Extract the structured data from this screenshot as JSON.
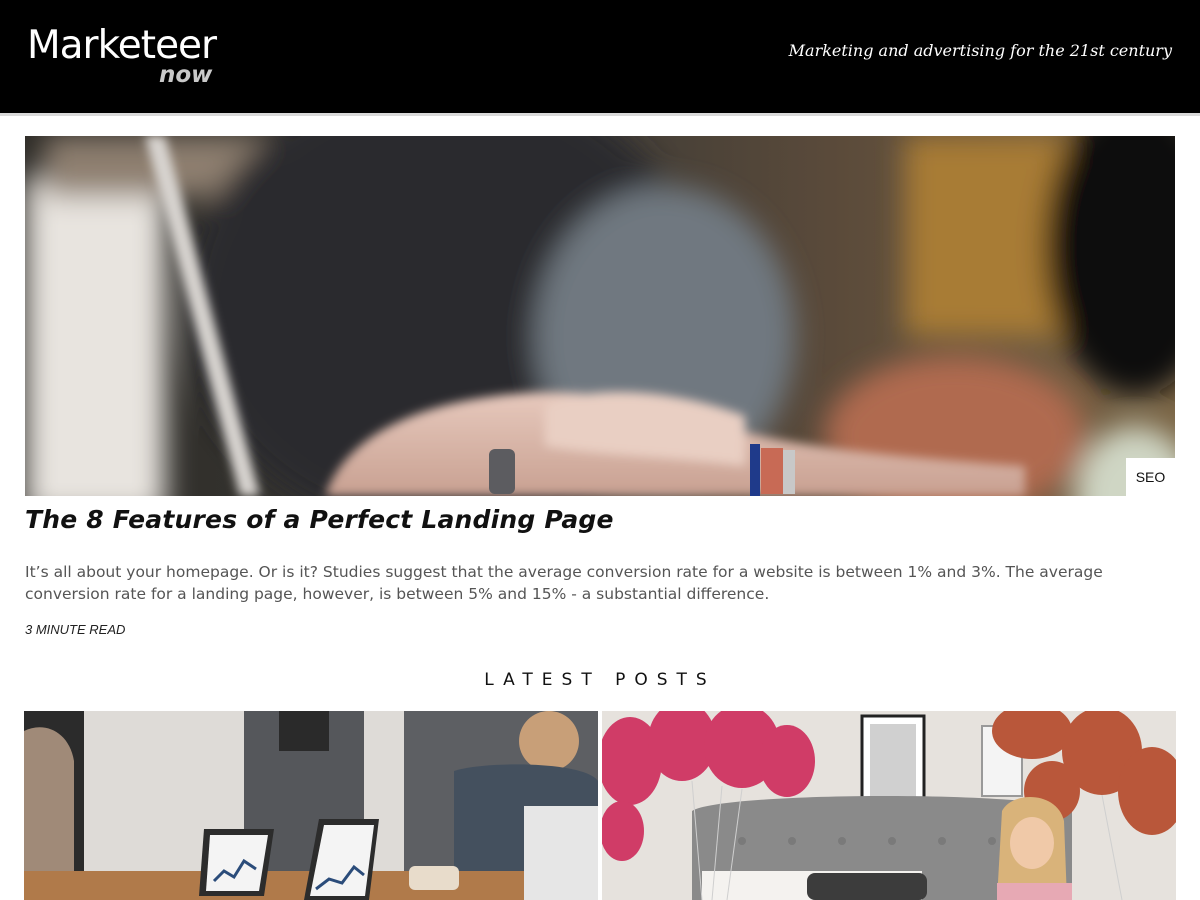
{
  "site": {
    "logo_main": "Marketeer",
    "logo_sub": "now",
    "tagline": "Marketing and advertising for the 21st century"
  },
  "featured": {
    "category": "SEO",
    "title": "The 8 Features of a Perfect Landing Page",
    "excerpt": "It’s all about your homepage. Or is it? Studies suggest that the average conversion rate for a website is between 1% and 3%. The average conversion rate for a landing page, however, is between 5% and 15% - a substantial difference.",
    "read_time": "3 MINUTE READ"
  },
  "latest": {
    "heading": "LATEST POSTS"
  },
  "colors": {
    "header_bg": "#000000",
    "header_border": "#d9d9d9",
    "body_text": "#555555"
  }
}
